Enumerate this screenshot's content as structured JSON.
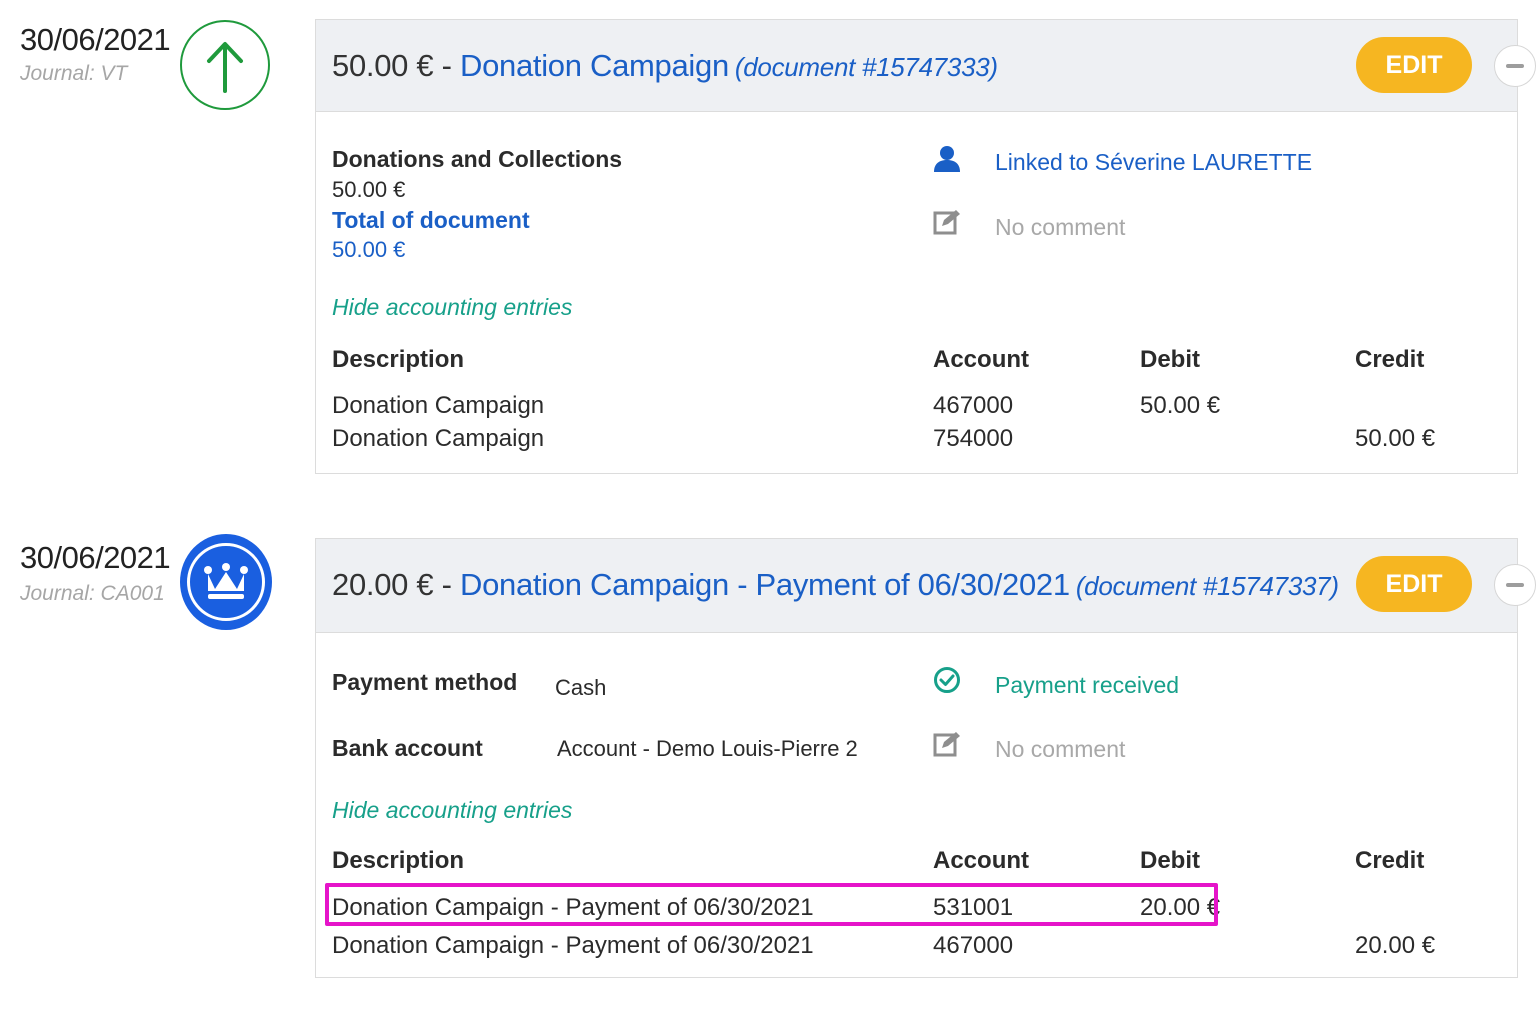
{
  "entries": [
    {
      "date": "30/06/2021",
      "journal": "Journal: VT",
      "badge_icon": "arrow-up-icon",
      "badge_color": "#1f9a3c",
      "header": {
        "amount": "50.00 € - ",
        "title": "Donation Campaign",
        "document": "(document #15747333)",
        "edit_label": "EDIT"
      },
      "details": {
        "category": "Donations and Collections",
        "category_amount": "50.00 €",
        "total_label": "Total of document",
        "total_amount": "50.00 €",
        "linked_icon": "user-icon",
        "linked_text": "Linked to Séverine LAURETTE",
        "comment_icon": "edit-note-icon",
        "comment_text": "No comment"
      },
      "toggle_label": "Hide accounting entries",
      "table": {
        "headers": [
          "Description",
          "Account",
          "Debit",
          "Credit"
        ],
        "rows": [
          {
            "description": "Donation Campaign",
            "account": "467000",
            "debit": "50.00 €",
            "credit": ""
          },
          {
            "description": "Donation Campaign",
            "account": "754000",
            "debit": "",
            "credit": "50.00 €"
          }
        ]
      }
    },
    {
      "date": "30/06/2021",
      "journal": "Journal: CA001",
      "badge_icon": "crown-icon",
      "badge_color": "#1a5fe0",
      "header": {
        "amount": "20.00 € - ",
        "title": "Donation Campaign - Payment of 06/30/2021",
        "document": "(document #15747337)",
        "edit_label": "EDIT"
      },
      "details": {
        "payment_method_label": "Payment method",
        "payment_method_value": "Cash",
        "bank_account_label": "Bank account",
        "bank_account_value": "Account - Demo Louis-Pierre 2",
        "status_icon": "check-circle-icon",
        "status_text": "Payment received",
        "comment_icon": "edit-note-icon",
        "comment_text": "No comment"
      },
      "toggle_label": "Hide accounting entries",
      "table": {
        "headers": [
          "Description",
          "Account",
          "Debit",
          "Credit"
        ],
        "rows": [
          {
            "description": "Donation Campaign - Payment of 06/30/2021",
            "account": "531001",
            "debit": "20.00 €",
            "credit": ""
          },
          {
            "description": "Donation Campaign - Payment of 06/30/2021",
            "account": "467000",
            "debit": "",
            "credit": "20.00 €"
          }
        ]
      }
    }
  ],
  "colors": {
    "accent_blue": "#1a5fc6",
    "teal": "#17a08a",
    "edit_button": "#f6b621",
    "highlight": "#e514c9"
  }
}
